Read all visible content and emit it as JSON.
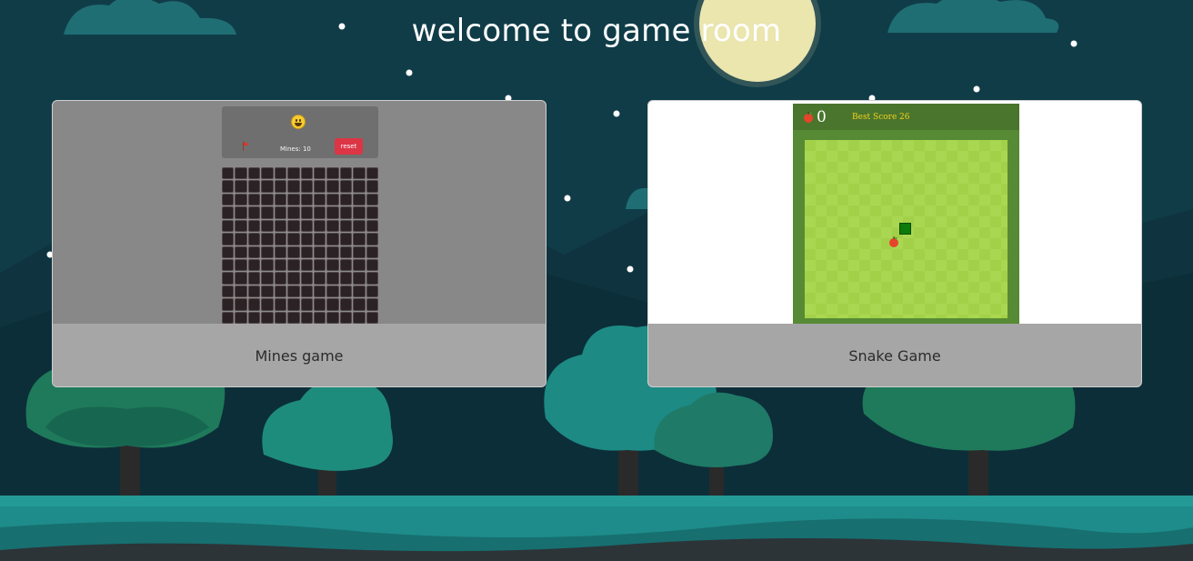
{
  "page": {
    "title": "welcome to game room"
  },
  "games": [
    {
      "label": "Mines game",
      "preview": {
        "face_icon": "smiley-face-icon",
        "flag_icon": "flag-icon",
        "mines_text": "Mines: 10",
        "reset_label": "reset"
      }
    },
    {
      "label": "Snake Game",
      "preview": {
        "apple_icon": "apple-icon",
        "score": "0",
        "best_score_label": "Best Score",
        "best_score_value": "26"
      }
    }
  ],
  "colors": {
    "background": "#0f3a46",
    "moon": "#f6edb3",
    "reset_button": "#dc3545",
    "best_score_text": "#f2d11e",
    "snake": "#0c7a0c"
  }
}
